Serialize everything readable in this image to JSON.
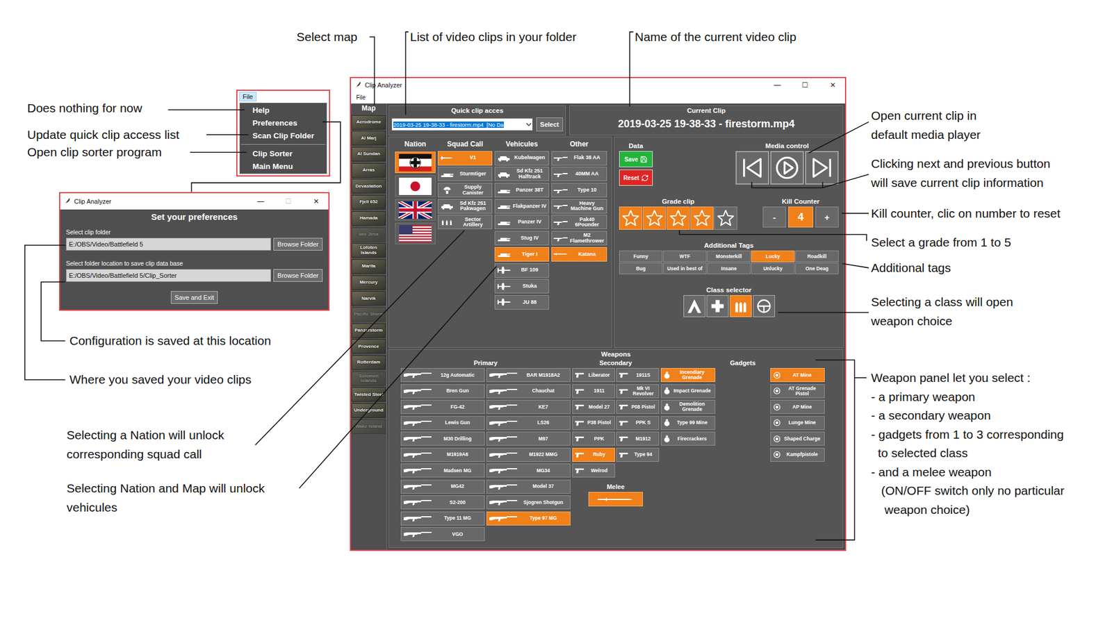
{
  "annotations": [
    {
      "lines": [
        "Select map"
      ]
    },
    {
      "lines": [
        "List of video clips in your folder"
      ]
    },
    {
      "lines": [
        "Name of the current video clip"
      ]
    },
    {
      "lines": [
        "Does nothing for now"
      ]
    },
    {
      "lines": [
        "Update quick clip access list"
      ]
    },
    {
      "lines": [
        "Open clip sorter program"
      ]
    },
    {
      "lines": [
        "Configuration is saved at this location"
      ]
    },
    {
      "lines": [
        "Where you saved your video clips"
      ]
    },
    {
      "lines": [
        "Selecting a Nation will unlock",
        "corresponding squad call"
      ]
    },
    {
      "lines": [
        "Selecting Nation and Map will unlock",
        "vehicules"
      ]
    },
    {
      "lines": [
        "Open current clip in",
        "default media player"
      ]
    },
    {
      "lines": [
        "Clicking next and previous button",
        "will save current clip information"
      ]
    },
    {
      "lines": [
        "Kill counter, clic on number to reset"
      ]
    },
    {
      "lines": [
        "Select a grade from 1 to 5"
      ]
    },
    {
      "lines": [
        "Additional tags"
      ]
    },
    {
      "lines": [
        "Selecting a class will open",
        "weapon choice"
      ]
    },
    {
      "lines": [
        "Weapon panel let you select :",
        "- a primary weapon",
        "- a secondary weapon",
        "- gadgets from 1 to 3 corresponding",
        "  to selected class",
        "- and a melee weapon",
        "   (ON/OFF switch only no particular",
        "    weapon choice)"
      ]
    }
  ],
  "file_menu": {
    "title": "File",
    "items": [
      {
        "label": "Help",
        "kind": "item"
      },
      {
        "label": "Preferences",
        "kind": "item"
      },
      {
        "label": "Scan Clip Folder",
        "kind": "item"
      },
      {
        "label": "",
        "kind": "separator"
      },
      {
        "label": "Clip Sorter",
        "kind": "item"
      },
      {
        "label": "Main Menu",
        "kind": "item"
      }
    ]
  },
  "preferences_window": {
    "title": "Clip Analyzer",
    "controls": [
      {
        "glyph": "—",
        "disabled": false
      },
      {
        "glyph": "☐",
        "disabled": true
      },
      {
        "glyph": "✕",
        "disabled": false
      }
    ],
    "heading": "Set your preferences",
    "fields": [
      {
        "label": "Select clip folder",
        "value": "E:/OBS/Video/Battlefield 5",
        "button": "Browse Folder"
      },
      {
        "label": "Select folder location to save clip data base",
        "value": "E:/OBS/Video/Battlefield 5/Clip_Sorter",
        "button": "Browse Folder"
      }
    ],
    "save_button": "Save and Exit"
  },
  "main_window": {
    "title": "Clip Analyzer",
    "controls": [
      {
        "glyph": "—",
        "disabled": false
      },
      {
        "glyph": "☐",
        "disabled": false
      },
      {
        "glyph": "✕",
        "disabled": false
      }
    ],
    "menu": [
      "File"
    ],
    "map_panel": {
      "title": "Map",
      "maps": [
        {
          "name": "Aerodrome",
          "disabled": false,
          "selected": false
        },
        {
          "name": "Al Marj",
          "disabled": false,
          "selected": false
        },
        {
          "name": "Al Sundan",
          "disabled": false,
          "selected": false
        },
        {
          "name": "Arras",
          "disabled": false,
          "selected": false
        },
        {
          "name": "Devastation",
          "disabled": false,
          "selected": false
        },
        {
          "name": "Fjell 652",
          "disabled": false,
          "selected": false
        },
        {
          "name": "Hamada",
          "disabled": false,
          "selected": false
        },
        {
          "name": "Iwo Jima",
          "disabled": true,
          "selected": false
        },
        {
          "name": "Lofoten Islands",
          "disabled": false,
          "selected": false
        },
        {
          "name": "Marita",
          "disabled": false,
          "selected": false
        },
        {
          "name": "Mercury",
          "disabled": false,
          "selected": false
        },
        {
          "name": "Narvik",
          "disabled": false,
          "selected": false
        },
        {
          "name": "Pacific Storm",
          "disabled": true,
          "selected": false
        },
        {
          "name": "Panzerstorm",
          "disabled": false,
          "selected": false
        },
        {
          "name": "Provence",
          "disabled": false,
          "selected": false
        },
        {
          "name": "Rotterdam",
          "disabled": false,
          "selected": false
        },
        {
          "name": "Solomon Islands",
          "disabled": true,
          "selected": false
        },
        {
          "name": "Twisted Steel",
          "disabled": false,
          "selected": false
        },
        {
          "name": "Underground",
          "disabled": false,
          "selected": false
        },
        {
          "name": "Wake Island",
          "disabled": true,
          "selected": false
        }
      ]
    },
    "quick_clip": {
      "title": "Quick clip acces",
      "value": "2019-03-25 19-38-33 - firestorm.mp4  [No Da",
      "button": "Select"
    },
    "current_clip": {
      "title": "Current Clip",
      "name": "2019-03-25 19-38-33 - firestorm.mp4"
    },
    "nations": {
      "title": "Nation",
      "items": [
        {
          "kind": "germany",
          "selected": true
        },
        {
          "kind": "japan",
          "selected": false
        },
        {
          "kind": "uk",
          "selected": false
        },
        {
          "kind": "usa",
          "selected": false
        }
      ]
    },
    "squad_call": {
      "title": "Squad Call",
      "items": [
        {
          "label": "V1",
          "kind": "rocket",
          "selected": true
        },
        {
          "label": "Sturmtiger",
          "kind": "tank",
          "selected": false
        },
        {
          "label": "Supply Canister",
          "kind": "crate",
          "selected": false
        },
        {
          "label": "Sd Kfz 251 Pakwagen",
          "kind": "car",
          "selected": false
        },
        {
          "label": "Sector Artillery",
          "kind": "shells",
          "selected": false
        }
      ]
    },
    "vehicles": {
      "title": "Vehicules",
      "items": [
        {
          "label": "Kubelwagen",
          "kind": "car",
          "selected": false
        },
        {
          "label": "Sd Kfz 251 Halftrack",
          "kind": "car",
          "selected": false
        },
        {
          "label": "Panzer 38T",
          "kind": "tank",
          "selected": false
        },
        {
          "label": "Flakpanzer IV",
          "kind": "tank",
          "selected": false
        },
        {
          "label": "Panzer IV",
          "kind": "tank",
          "selected": false
        },
        {
          "label": "Stug IV",
          "kind": "tank",
          "selected": false
        },
        {
          "label": "Tiger I",
          "kind": "tank",
          "selected": true
        },
        {
          "label": "BF 109",
          "kind": "plane",
          "selected": false
        },
        {
          "label": "Stuka",
          "kind": "plane",
          "selected": false
        },
        {
          "label": "JU 88",
          "kind": "plane",
          "selected": false
        }
      ]
    },
    "other": {
      "title": "Other",
      "items": [
        {
          "label": "Flak 38 AA",
          "kind": "gun",
          "selected": false
        },
        {
          "label": "40MM AA",
          "kind": "gun",
          "selected": false
        },
        {
          "label": "Type 10",
          "kind": "gun",
          "selected": false
        },
        {
          "label": "Heavy Machine Gun",
          "kind": "gun",
          "selected": false
        },
        {
          "label": "Pak40 6Pounder",
          "kind": "gun",
          "selected": false
        },
        {
          "label": "M2 Flamethrower",
          "kind": "gun",
          "selected": false
        },
        {
          "label": "Katana",
          "kind": "blade",
          "selected": true
        }
      ]
    },
    "data": {
      "title": "Data",
      "save": "Save",
      "reset": "Reset"
    },
    "media": {
      "title": "Media control"
    },
    "grade": {
      "title": "Grade clip",
      "stars": 4,
      "total": 5
    },
    "kill_counter": {
      "title": "Kill Counter",
      "minus": "-",
      "value": "4",
      "plus": "+"
    },
    "tags": {
      "title": "Additional Tags",
      "items": [
        {
          "label": "Funny",
          "selected": false
        },
        {
          "label": "WTF",
          "selected": false
        },
        {
          "label": "Monsterkill",
          "selected": false
        },
        {
          "label": "Lucky",
          "selected": true
        },
        {
          "label": "Roadkill",
          "selected": false
        },
        {
          "label": "Bug",
          "selected": false
        },
        {
          "label": "Used in best of",
          "selected": false
        },
        {
          "label": "Insane",
          "selected": false
        },
        {
          "label": "Unlucky",
          "selected": false
        },
        {
          "label": "One Deag",
          "selected": false
        }
      ]
    },
    "class_selector": {
      "title": "Class selector",
      "items": [
        {
          "kind": "assault",
          "selected": false
        },
        {
          "kind": "medic",
          "selected": false
        },
        {
          "kind": "support",
          "selected": true
        },
        {
          "kind": "recon",
          "selected": false
        }
      ]
    },
    "weapons": {
      "title": "Weapons",
      "primary": {
        "title": "Primary",
        "columns": [
          [
            {
              "label": "12g Automatic",
              "selected": false
            },
            {
              "label": "Bren Gun",
              "selected": false
            },
            {
              "label": "FG-42",
              "selected": false
            },
            {
              "label": "Lewis Gun",
              "selected": false
            },
            {
              "label": "M30 Drilling",
              "selected": false
            },
            {
              "label": "M1919A6",
              "selected": false
            },
            {
              "label": "Madsen MG",
              "selected": false
            },
            {
              "label": "MG42",
              "selected": false
            },
            {
              "label": "S2-200",
              "selected": false
            },
            {
              "label": "Type 11 MG",
              "selected": false
            },
            {
              "label": "VGO",
              "selected": false
            }
          ],
          [
            {
              "label": "BAR M1918A2",
              "selected": false
            },
            {
              "label": "Chauchat",
              "selected": false
            },
            {
              "label": "KE7",
              "selected": false
            },
            {
              "label": "LS26",
              "selected": false
            },
            {
              "label": "M97",
              "selected": false
            },
            {
              "label": "M1922 MMG",
              "selected": false
            },
            {
              "label": "MG34",
              "selected": false
            },
            {
              "label": "Model 37",
              "selected": false
            },
            {
              "label": "Sjogren Shotgun",
              "selected": false
            },
            {
              "label": "Type 97 MG",
              "selected": true
            }
          ]
        ]
      },
      "secondary": {
        "title": "Secondary",
        "columns": [
          [
            {
              "label": "Liberator",
              "selected": false
            },
            {
              "label": "1911",
              "selected": false
            },
            {
              "label": "Model 27",
              "selected": false
            },
            {
              "label": "P38 Pistol",
              "selected": false
            },
            {
              "label": "PPK",
              "selected": false
            },
            {
              "label": "Ruby",
              "selected": true
            },
            {
              "label": "Welrod",
              "selected": false
            }
          ],
          [
            {
              "label": "1911S",
              "selected": false
            },
            {
              "label": "Mk VI Revolver",
              "selected": false
            },
            {
              "label": "P08 Pistol",
              "selected": false
            },
            {
              "label": "PPK S",
              "selected": false
            },
            {
              "label": "M1912",
              "selected": false
            },
            {
              "label": "Type 94",
              "selected": false
            }
          ]
        ]
      },
      "melee": {
        "title": "Melee",
        "selected": true
      },
      "gadgets": {
        "title": "Gadgets",
        "grenades": [
          {
            "label": "Incendiary Grenade",
            "selected": true
          },
          {
            "label": "Impact Grenade",
            "selected": false
          },
          {
            "label": "Demolition Grenade",
            "selected": false
          },
          {
            "label": "Type 99 Mine",
            "selected": false
          },
          {
            "label": "Firecrackers",
            "selected": false
          }
        ],
        "items": [
          {
            "label": "AT Mine",
            "selected": true
          },
          {
            "label": "AT Grenade Pistol",
            "selected": false
          },
          {
            "label": "AP Mine",
            "selected": false
          },
          {
            "label": "Lunge Mine",
            "selected": false
          },
          {
            "label": "Shaped Charge",
            "selected": false
          },
          {
            "label": "Kampfpistole",
            "selected": false
          }
        ]
      }
    }
  }
}
